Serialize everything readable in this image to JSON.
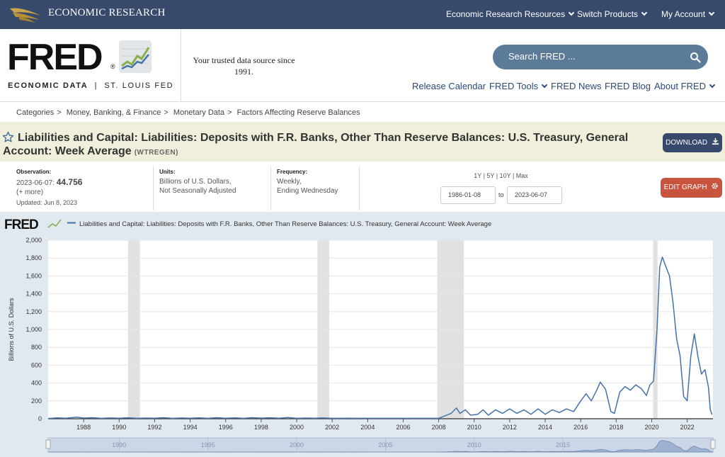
{
  "topbar": {
    "brand": "ECONOMIC RESEARCH",
    "nav": [
      {
        "label": "Economic Research Resources"
      },
      {
        "label": "Switch Products"
      },
      {
        "label": "My Account"
      }
    ]
  },
  "header": {
    "logo_word": "FRED",
    "logo_reg": "®",
    "logo_sub_left": "ECONOMIC DATA",
    "logo_sub_sep": "|",
    "logo_sub_right": "ST. LOUIS FED",
    "tagline": "Your trusted data source since 1991.",
    "search_placeholder": "Search FRED ...",
    "nav": [
      {
        "label": "Release Calendar"
      },
      {
        "label": "FRED Tools"
      },
      {
        "label": "FRED News"
      },
      {
        "label": "FRED Blog"
      },
      {
        "label": "About FRED"
      }
    ]
  },
  "breadcrumb": [
    "Categories",
    "Money, Banking, & Finance",
    "Monetary Data",
    "Factors Affecting Reserve Balances"
  ],
  "series": {
    "title": "Liabilities and Capital: Liabilities: Deposits with F.R. Banks, Other Than Reserve Balances: U.S. Treasury, General Account: Week Average",
    "id": "(WTREGEN)",
    "download_label": "DOWNLOAD",
    "edit_label": "EDIT GRAPH"
  },
  "meta": {
    "observation_label": "Observation:",
    "observation_date": "2023-06-07:",
    "observation_value": "44.756",
    "more": "(+ more)",
    "updated": "Updated: Jun 8, 2023",
    "units_label": "Units:",
    "units_line1": "Billions of U.S. Dollars,",
    "units_line2": "Not Seasonally Adjusted",
    "frequency_label": "Frequency:",
    "frequency_line1": "Weekly,",
    "frequency_line2": "Ending Wednesday",
    "range_links": "1Y | 5Y | 10Y | Max",
    "start_date": "1986-01-08",
    "to": "to",
    "end_date": "2023-06-07"
  },
  "colors": {
    "topbar": "#374a6b",
    "accent": "#2c4a7a",
    "line": "#4572a7",
    "edit_button": "#c9543d",
    "title_band": "#f0efdc",
    "chart_panel": "#e1e9f0",
    "recession": "#e1e1e1"
  },
  "chart_data": {
    "type": "line",
    "legend_logo": "FRED",
    "series": [
      {
        "name": "Liabilities and Capital: Liabilities: Deposits with F.R. Banks, Other Than Reserve Balances: U.S. Treasury, General Account: Week Average",
        "points": [
          [
            1986.0,
            3
          ],
          [
            1986.5,
            10
          ],
          [
            1987.0,
            6
          ],
          [
            1987.6,
            18
          ],
          [
            1988.0,
            8
          ],
          [
            1988.5,
            12
          ],
          [
            1989.0,
            5
          ],
          [
            1989.5,
            9
          ],
          [
            1990.0,
            6
          ],
          [
            1990.5,
            11
          ],
          [
            1991.0,
            5
          ],
          [
            1991.5,
            8
          ],
          [
            1992.0,
            6
          ],
          [
            1992.5,
            12
          ],
          [
            1993.0,
            5
          ],
          [
            1993.5,
            9
          ],
          [
            1994.0,
            6
          ],
          [
            1994.5,
            10
          ],
          [
            1995.0,
            5
          ],
          [
            1995.5,
            12
          ],
          [
            1996.0,
            6
          ],
          [
            1996.5,
            10
          ],
          [
            1997.0,
            5
          ],
          [
            1997.5,
            12
          ],
          [
            1998.0,
            7
          ],
          [
            1998.5,
            11
          ],
          [
            1999.0,
            6
          ],
          [
            1999.5,
            14
          ],
          [
            2000.0,
            5
          ],
          [
            2000.5,
            8
          ],
          [
            2001.0,
            6
          ],
          [
            2001.5,
            9
          ],
          [
            2002.0,
            5
          ],
          [
            2003.0,
            6
          ],
          [
            2004.0,
            5
          ],
          [
            2005.0,
            5
          ],
          [
            2006.0,
            5
          ],
          [
            2007.0,
            5
          ],
          [
            2008.0,
            5
          ],
          [
            2008.7,
            60
          ],
          [
            2009.0,
            120
          ],
          [
            2009.2,
            60
          ],
          [
            2009.5,
            100
          ],
          [
            2009.8,
            40
          ],
          [
            2010.2,
            50
          ],
          [
            2010.5,
            100
          ],
          [
            2010.8,
            40
          ],
          [
            2011.2,
            100
          ],
          [
            2011.6,
            60
          ],
          [
            2012.0,
            110
          ],
          [
            2012.4,
            60
          ],
          [
            2012.8,
            100
          ],
          [
            2013.2,
            50
          ],
          [
            2013.6,
            110
          ],
          [
            2014.0,
            50
          ],
          [
            2014.4,
            100
          ],
          [
            2014.8,
            70
          ],
          [
            2015.2,
            110
          ],
          [
            2015.6,
            80
          ],
          [
            2016.0,
            200
          ],
          [
            2016.3,
            280
          ],
          [
            2016.6,
            200
          ],
          [
            2016.9,
            320
          ],
          [
            2017.1,
            410
          ],
          [
            2017.4,
            330
          ],
          [
            2017.7,
            80
          ],
          [
            2017.9,
            60
          ],
          [
            2018.2,
            300
          ],
          [
            2018.5,
            360
          ],
          [
            2018.8,
            320
          ],
          [
            2019.1,
            380
          ],
          [
            2019.4,
            340
          ],
          [
            2019.7,
            260
          ],
          [
            2019.9,
            380
          ],
          [
            2020.1,
            420
          ],
          [
            2020.3,
            1000
          ],
          [
            2020.45,
            1700
          ],
          [
            2020.6,
            1810
          ],
          [
            2020.8,
            1700
          ],
          [
            2021.0,
            1600
          ],
          [
            2021.2,
            1300
          ],
          [
            2021.4,
            900
          ],
          [
            2021.6,
            700
          ],
          [
            2021.8,
            250
          ],
          [
            2022.0,
            200
          ],
          [
            2022.2,
            700
          ],
          [
            2022.4,
            950
          ],
          [
            2022.6,
            700
          ],
          [
            2022.8,
            500
          ],
          [
            2023.0,
            550
          ],
          [
            2023.2,
            350
          ],
          [
            2023.3,
            100
          ],
          [
            2023.4,
            45
          ]
        ]
      }
    ],
    "ylabel": "Billions of U.S. Dollars",
    "ylim": [
      0,
      2000
    ],
    "yticks": [
      "0",
      "200",
      "400",
      "600",
      "800",
      "1,000",
      "1,200",
      "1,400",
      "1,600",
      "1,800",
      "2,000"
    ],
    "xlim": [
      1986.0,
      2023.45
    ],
    "xticks": [
      "1988",
      "1990",
      "1992",
      "1994",
      "1996",
      "1998",
      "2000",
      "2002",
      "2004",
      "2006",
      "2008",
      "2010",
      "2012",
      "2014",
      "2016",
      "2018",
      "2020",
      "2022"
    ],
    "recessions": [
      [
        1990.5,
        1991.17
      ],
      [
        2001.17,
        2001.83
      ],
      [
        2007.92,
        2009.42
      ],
      [
        2020.08,
        2020.33
      ]
    ],
    "navigator_ticks": [
      "1990",
      "1995",
      "2000",
      "2005",
      "2010",
      "2015"
    ],
    "grid": true
  }
}
